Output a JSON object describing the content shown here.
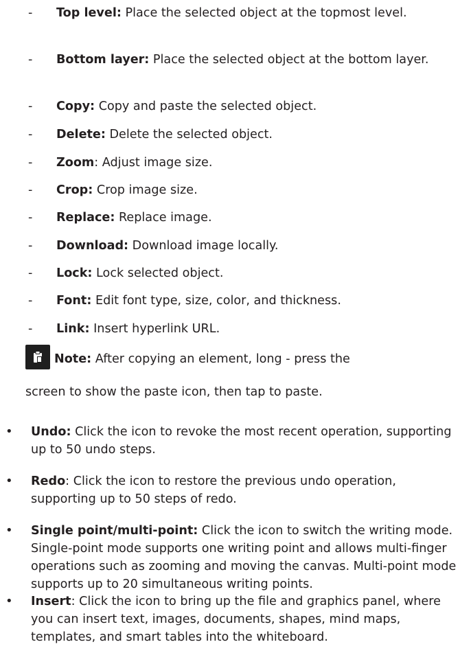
{
  "sub_items": [
    {
      "term": "Top level:",
      "desc": " Place the selected object at the topmost level."
    },
    {
      "term": "Bottom layer:",
      "desc": " Place the selected object at the bottom layer."
    },
    {
      "term": "Copy:",
      "desc": " Copy and paste the selected object."
    },
    {
      "term": "Delete:",
      "desc": " Delete the selected object."
    },
    {
      "term": "Zoom",
      "desc": ": Adjust image size."
    },
    {
      "term": "Crop:",
      "desc": " Crop image size."
    },
    {
      "term": "Replace:",
      "desc": " Replace image."
    },
    {
      "term": "Download:",
      "desc": " Download image locally."
    },
    {
      "term": "Lock:",
      "desc": " Lock selected object."
    },
    {
      "term": "Font:",
      "desc": " Edit font type, size, color, and thickness."
    },
    {
      "term": "Link:",
      "desc": " Insert hyperlink URL."
    }
  ],
  "note": {
    "icon": "clipboard-note-icon",
    "term": "Note:",
    "line1": " After copying an element, long - press the",
    "line2": "screen to show the paste icon, then tap to paste."
  },
  "main_items": [
    {
      "term": "Undo:",
      "desc": " Click the icon to revoke the most recent operation, supporting up to 50 undo steps."
    },
    {
      "term": "Redo",
      "desc": ": Click the icon to restore the previous undo operation, supporting up to 50 steps of redo."
    },
    {
      "term": "Single point/multi-point:",
      "desc": " Click the icon to switch the writing mode. Single-point mode supports one writing point and allows multi-finger operations such as zooming and moving the canvas. Multi-point mode supports up to 20 simultaneous writing points."
    },
    {
      "term": "Insert",
      "desc": ": Click the icon to bring up the file and graphics panel, where you can insert text, images, documents, shapes, mind maps, templates, and smart tables into the whiteboard."
    }
  ],
  "marks": {
    "dash": "-",
    "bullet": "•"
  }
}
